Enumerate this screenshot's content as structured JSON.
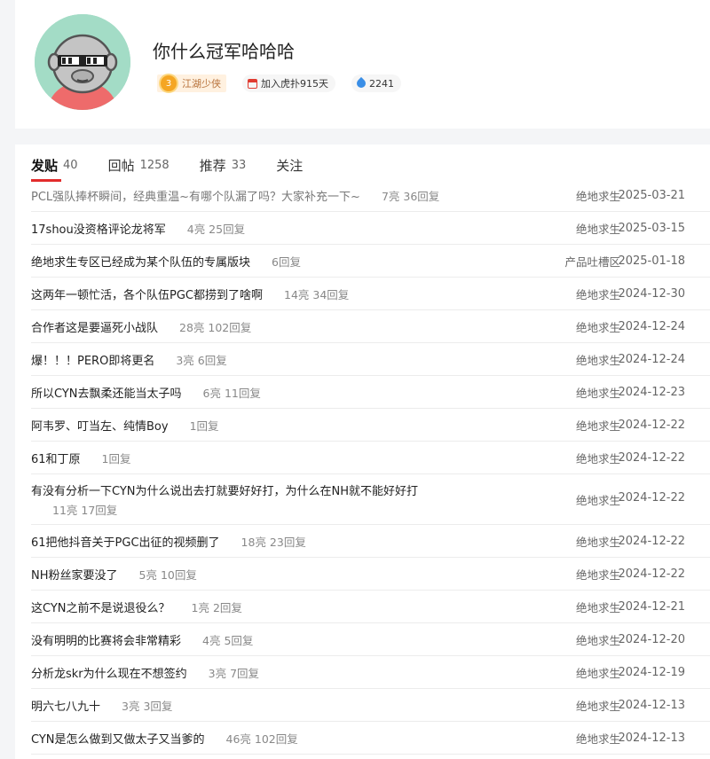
{
  "profile": {
    "username": "你什么冠军哈哈哈",
    "level_number": "3",
    "level_label": "江湖少侠",
    "join_text": "加入虎扑915天",
    "points": "2241"
  },
  "tabs": [
    {
      "label": "发贴",
      "count": "40"
    },
    {
      "label": "回帖",
      "count": "1258"
    },
    {
      "label": "推荐",
      "count": "33"
    },
    {
      "label": "关注",
      "count": ""
    }
  ],
  "posts": [
    {
      "title": "PCL强队捧杯瞬间，经典重温~有哪个队漏了吗？大家补充一下~",
      "meta": "7亮 36回复",
      "forum": "绝地求生",
      "date": "2025-03-21"
    },
    {
      "title": "17shou没资格评论龙将军",
      "meta": "4亮 25回复",
      "forum": "绝地求生",
      "date": "2025-03-15"
    },
    {
      "title": "绝地求生专区已经成为某个队伍的专属版块",
      "meta": "6回复",
      "forum": "产品吐槽区",
      "date": "2025-01-18"
    },
    {
      "title": "这两年一顿忙活，各个队伍PGC都捞到了啥啊",
      "meta": "14亮 34回复",
      "forum": "绝地求生",
      "date": "2024-12-30"
    },
    {
      "title": "合作者这是要逼死小战队",
      "meta": "28亮 102回复",
      "forum": "绝地求生",
      "date": "2024-12-24"
    },
    {
      "title": "爆！！！PERO即将更名",
      "meta": "3亮 6回复",
      "forum": "绝地求生",
      "date": "2024-12-24"
    },
    {
      "title": "所以CYN去飘柔还能当太子吗",
      "meta": "6亮 11回复",
      "forum": "绝地求生",
      "date": "2024-12-23"
    },
    {
      "title": "阿韦罗、叮当左、纯情Boy",
      "meta": "1回复",
      "forum": "绝地求生",
      "date": "2024-12-22"
    },
    {
      "title": "61和丁原",
      "meta": "1回复",
      "forum": "绝地求生",
      "date": "2024-12-22"
    },
    {
      "title": "有没有分析一下CYN为什么说出去打就要好好打，为什么在NH就不能好好打",
      "meta": "11亮 17回复",
      "forum": "绝地求生",
      "date": "2024-12-22"
    },
    {
      "title": "61把他抖音关于PGC出征的视频删了",
      "meta": "18亮 23回复",
      "forum": "绝地求生",
      "date": "2024-12-22"
    },
    {
      "title": "NH粉丝家要没了",
      "meta": "5亮 10回复",
      "forum": "绝地求生",
      "date": "2024-12-22"
    },
    {
      "title": "这CYN之前不是说退役么？",
      "meta": "1亮 2回复",
      "forum": "绝地求生",
      "date": "2024-12-21"
    },
    {
      "title": "没有明明的比赛将会非常精彩",
      "meta": "4亮 5回复",
      "forum": "绝地求生",
      "date": "2024-12-20"
    },
    {
      "title": "分析龙skr为什么现在不想签约",
      "meta": "3亮 7回复",
      "forum": "绝地求生",
      "date": "2024-12-19"
    },
    {
      "title": "明六七八九十",
      "meta": "3亮 3回复",
      "forum": "绝地求生",
      "date": "2024-12-13"
    },
    {
      "title": "CYN是怎么做到又做太子又当爹的",
      "meta": "46亮 102回复",
      "forum": "绝地求生",
      "date": "2024-12-13"
    }
  ]
}
